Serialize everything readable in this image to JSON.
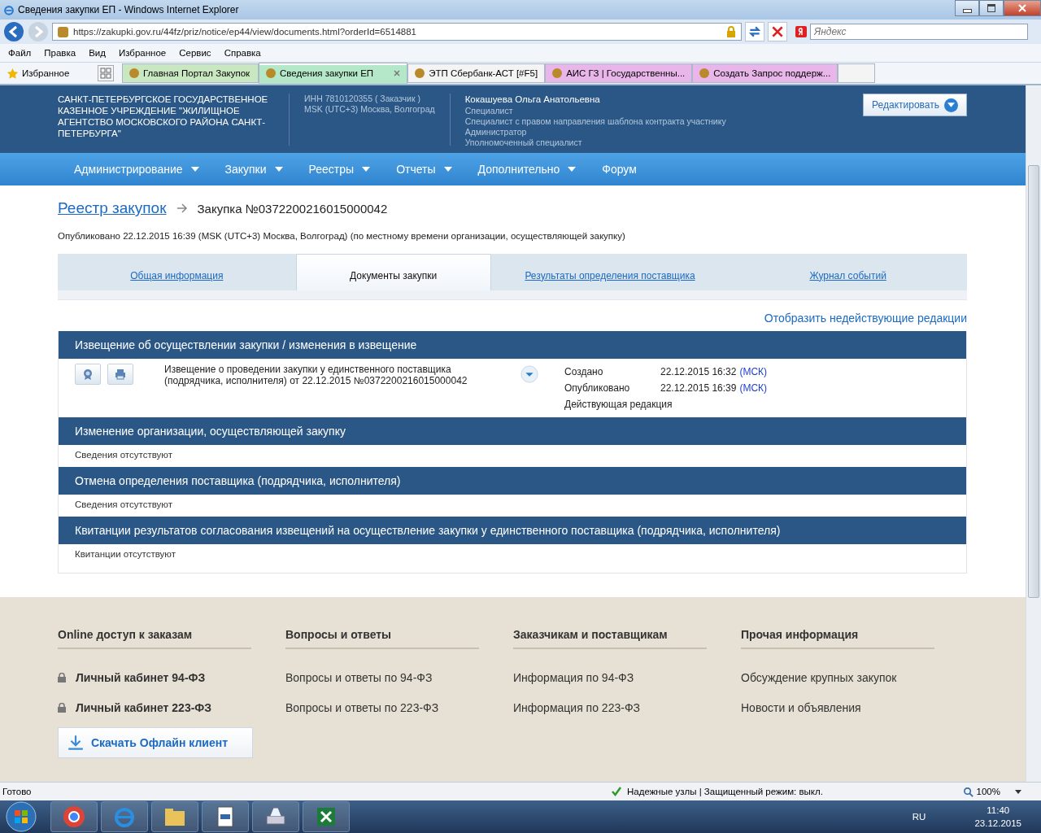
{
  "browser": {
    "title": "Сведения закупки ЕП - Windows Internet Explorer",
    "address": "https://zakupki.gov.ru/44fz/priz/notice/ep44/view/documents.html?orderId=6514881",
    "search_placeholder": "Яндекс",
    "menu": [
      "Файл",
      "Правка",
      "Вид",
      "Избранное",
      "Сервис",
      "Справка"
    ],
    "favorites_label": "Избранное",
    "tabs": [
      {
        "label": "Главная Портал Закупок",
        "selected": false,
        "color": "#c9e7c0"
      },
      {
        "label": "Сведения закупки ЕП",
        "selected": true,
        "color": "#b5e8c9"
      },
      {
        "label": "ЭТП Сбербанк-АСТ [#F5]",
        "selected": false,
        "color": "#f4f4f4"
      },
      {
        "label": "АИС ГЗ | Государственны...",
        "selected": false,
        "color": "#e9b6ea"
      },
      {
        "label": "Создать Запрос поддерж...",
        "selected": false,
        "color": "#e9b6ea"
      }
    ]
  },
  "header": {
    "organization": "САНКТ-ПЕТЕРБУРГСКОЕ ГОСУДАРСТВЕННОЕ КАЗЕННОЕ УЧРЕЖДЕНИЕ \"ЖИЛИЩНОЕ АГЕНТСТВО МОСКОВСКОГО РАЙОНА САНКТ-ПЕТЕРБУРГА\"",
    "inn": "ИНН 7810120355 ( Заказчик )",
    "timezone": "MSK (UTC+3) Москва, Волгоград",
    "user_name": "Кокашуева Ольга Анатольевна",
    "roles": [
      "Специалист",
      "Специалист с правом направления шаблона контракта участнику",
      "Администратор",
      "Уполномоченный специалист"
    ],
    "edit_button": "Редактировать"
  },
  "nav": [
    {
      "label": "Администрирование",
      "has_dropdown": true
    },
    {
      "label": "Закупки",
      "has_dropdown": true
    },
    {
      "label": "Реестры",
      "has_dropdown": true
    },
    {
      "label": "Отчеты",
      "has_dropdown": true
    },
    {
      "label": "Дополнительно",
      "has_dropdown": true
    },
    {
      "label": "Форум",
      "has_dropdown": false
    }
  ],
  "breadcrumb": {
    "link": "Реестр закупок",
    "current": "Закупка №0372200216015000042"
  },
  "published": "Опубликовано 22.12.2015 16:39 (MSK (UTC+3) Москва, Волгоград) (по местному времени организации, осуществляющей закупку)",
  "page_tabs": [
    {
      "label": "Общая информация",
      "selected": false
    },
    {
      "label": "Документы закупки",
      "selected": true
    },
    {
      "label": "Результаты определения поставщика",
      "selected": false
    },
    {
      "label": "Журнал событий",
      "selected": false
    }
  ],
  "show_inactive_link": "Отобразить недействующие редакции",
  "sections": [
    {
      "title": "Извещение об осуществлении закупки / изменения в извещение",
      "kind": "document",
      "document": {
        "name": "Извещение о проведении закупки у единственного поставщика (подрядчика, исполнителя) от 22.12.2015 №0372200216015000042",
        "meta": [
          {
            "label": "Создано",
            "value": "22.12.2015 16:32",
            "zone": "(МСК)"
          },
          {
            "label": "Опубликовано",
            "value": "22.12.2015 16:39",
            "zone": "(МСК)"
          }
        ],
        "status": "Действующая редакция"
      }
    },
    {
      "title": "Изменение организации, осуществляющей закупку",
      "kind": "empty",
      "text": "Сведения отсутствуют"
    },
    {
      "title": "Отмена определения поставщика (подрядчика, исполнителя)",
      "kind": "empty",
      "text": "Сведения отсутствуют"
    },
    {
      "title": "Квитанции результатов согласования извещений на осуществление закупки у единственного поставщика (подрядчика, исполнителя)",
      "kind": "empty",
      "text": "Квитанции отсутствуют"
    }
  ],
  "footer": {
    "columns": [
      {
        "heading": "Online доступ к заказам",
        "links": [
          {
            "label": "Личный кабинет 94-ФЗ",
            "locked": true
          },
          {
            "label": "Личный кабинет 223-ФЗ",
            "locked": true
          }
        ]
      },
      {
        "heading": "Вопросы и ответы",
        "links": [
          {
            "label": "Вопросы и ответы по 94-ФЗ",
            "locked": false
          },
          {
            "label": "Вопросы и ответы по 223-ФЗ",
            "locked": false
          }
        ]
      },
      {
        "heading": "Заказчикам и поставщикам",
        "links": [
          {
            "label": "Информация по 94-ФЗ",
            "locked": false
          },
          {
            "label": "Информация по 223-ФЗ",
            "locked": false
          }
        ]
      },
      {
        "heading": "Прочая информация",
        "links": [
          {
            "label": "Обсуждение крупных закупок",
            "locked": false
          },
          {
            "label": "Новости и объявления",
            "locked": false
          }
        ]
      }
    ],
    "download_button": "Скачать Офлайн клиент"
  },
  "status_bar": {
    "status": "Готово",
    "security": "Надежные узлы | Защищенный режим: выкл.",
    "zoom": "100%"
  },
  "taskbar": {
    "language": "RU",
    "time": "11:40",
    "date": "23.12.2015"
  }
}
